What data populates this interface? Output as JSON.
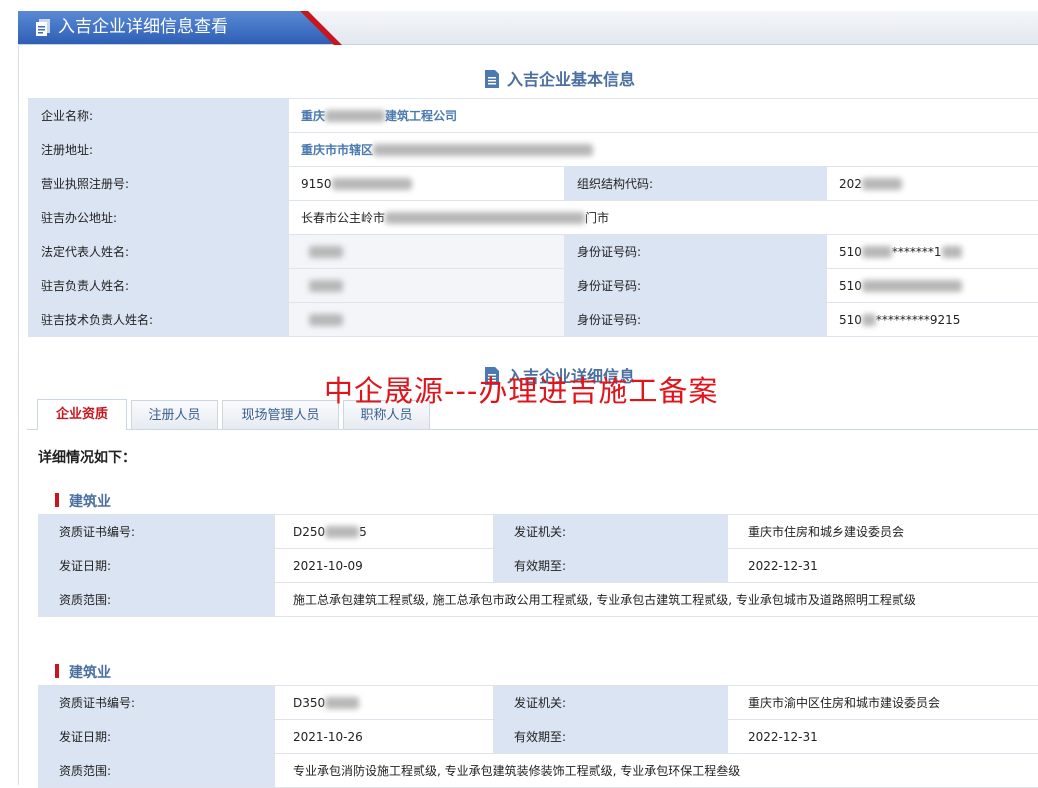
{
  "header": {
    "title": "入吉企业详细信息查看",
    "icon": "document-icon"
  },
  "basic": {
    "section_title": "入吉企业基本信息",
    "rows": [
      {
        "label": "企业名称:",
        "value_prefix": "重庆",
        "value_suffix": "建筑工程公司"
      },
      {
        "label": "注册地址:",
        "value_prefix": "重庆市市辖区"
      },
      {
        "label": "营业执照注册号:",
        "value_prefix": "9150",
        "label2": "组织结构代码:",
        "value2_prefix": "202"
      },
      {
        "label": "驻吉办公地址:",
        "value_prefix": "长春市公主岭市",
        "value_suffix": "门市"
      },
      {
        "label": "法定代表人姓名:",
        "label2": "身份证号码:",
        "value2_prefix": "510",
        "value2_suffix": "*******1"
      },
      {
        "label": "驻吉负责人姓名:",
        "label2": "身份证号码:",
        "value2_prefix": "510"
      },
      {
        "label": "驻吉技术负责人姓名:",
        "label2": "身份证号码:",
        "value2_prefix": "510",
        "value2_suffix": "*********9215"
      }
    ]
  },
  "detail": {
    "section_title": "入吉企业详细信息",
    "tabs": [
      "企业资质",
      "注册人员",
      "现场管理人员",
      "职称人员"
    ],
    "active_tab": 0,
    "intro": "详细情况如下：",
    "labels": {
      "cert_no": "资质证书编号:",
      "issuer": "发证机关:",
      "issue_date": "发证日期:",
      "valid_until": "有效期至:",
      "scope": "资质范围:"
    },
    "qualifications": [
      {
        "category": "建筑业",
        "cert_no_prefix": "D250",
        "cert_no_suffix": "5",
        "issuer": "重庆市住房和城乡建设委员会",
        "issue_date": "2021-10-09",
        "valid_until": "2022-12-31",
        "scope": "施工总承包建筑工程贰级, 施工总承包市政公用工程贰级, 专业承包古建筑工程贰级, 专业承包城市及道路照明工程贰级"
      },
      {
        "category": "建筑业",
        "cert_no_prefix": "D350",
        "issuer": "重庆市渝中区住房和城市建设委员会",
        "issue_date": "2021-10-26",
        "valid_until": "2022-12-31",
        "scope": "专业承包消防设施工程贰级, 专业承包建筑装修装饰工程贰级, 专业承包环保工程叁级"
      }
    ]
  },
  "watermark": "中企晟源---办理进吉施工备案",
  "colors": {
    "accent_blue": "#2e5fb5",
    "accent_red": "#c8161e",
    "label_bg": "#dbe4f3",
    "link_text": "#4a7ab0"
  }
}
